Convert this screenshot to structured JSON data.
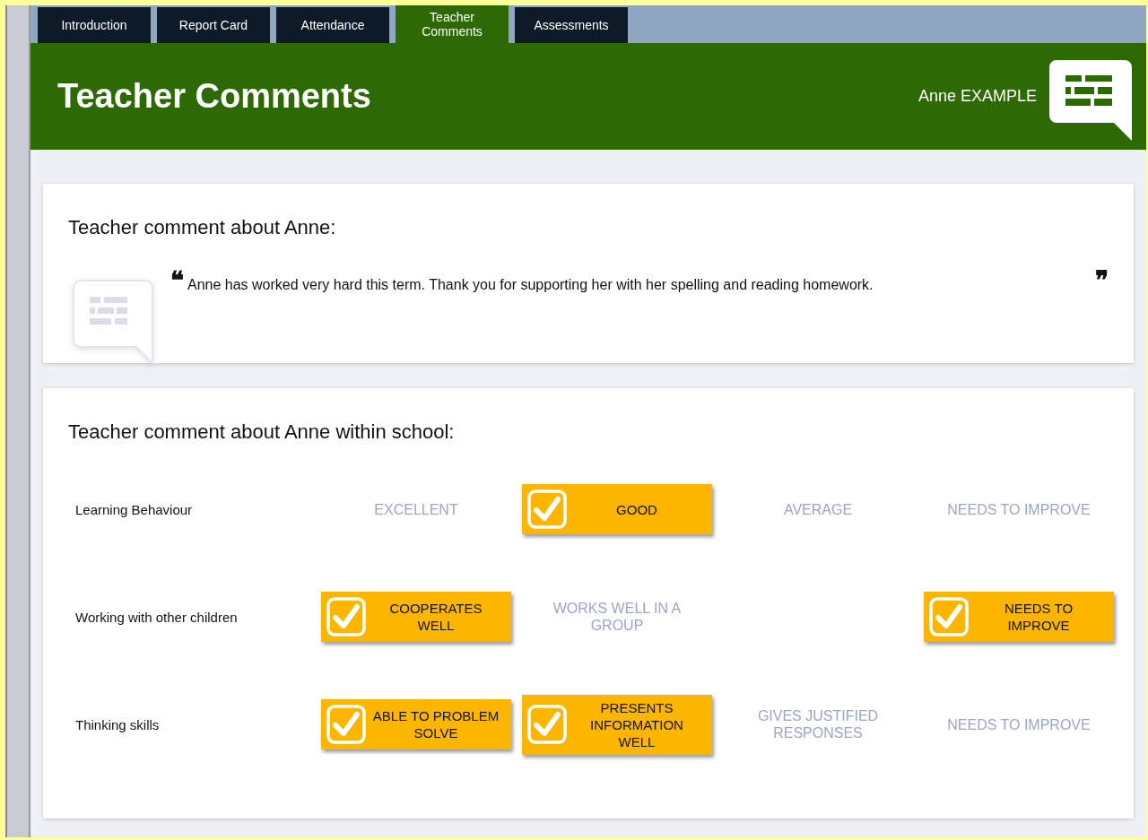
{
  "tabs": [
    {
      "label": "Introduction",
      "selected": false
    },
    {
      "label": "Report Card",
      "selected": false
    },
    {
      "label": "Attendance",
      "selected": false
    },
    {
      "label": "Teacher Comments",
      "selected": true
    },
    {
      "label": "Assessments",
      "selected": false
    }
  ],
  "header": {
    "title": "Teacher Comments",
    "student": "Anne EXAMPLE"
  },
  "comment_card": {
    "heading": "Teacher comment about Anne:",
    "open_quote": "❝",
    "comment": "Anne has worked very hard this term. Thank you for supporting her with her spelling and reading homework.",
    "close_quote": "❞"
  },
  "school_card": {
    "heading": "Teacher comment about Anne within school:",
    "rows": [
      {
        "label": "Learning Behaviour",
        "options": [
          {
            "label": "EXCELLENT",
            "selected": false
          },
          {
            "label": "GOOD",
            "selected": true
          },
          {
            "label": "AVERAGE",
            "selected": false
          },
          {
            "label": "NEEDS TO IMPROVE",
            "selected": false
          }
        ]
      },
      {
        "label": "Working with other children",
        "options": [
          {
            "label": "COOPERATES WELL",
            "selected": true
          },
          {
            "label": "WORKS WELL IN A GROUP",
            "selected": false
          },
          {
            "label": "NEEDS TO IMPROVE",
            "selected": true
          }
        ]
      },
      {
        "label": "Thinking skills",
        "options": [
          {
            "label": "ABLE TO PROBLEM SOLVE",
            "selected": true
          },
          {
            "label": "PRESENTS INFORMATION WELL",
            "selected": true
          },
          {
            "label": "GIVES JUSTIFIED RESPONSES",
            "selected": false
          },
          {
            "label": "NEEDS TO IMPROVE",
            "selected": false
          }
        ]
      }
    ]
  }
}
